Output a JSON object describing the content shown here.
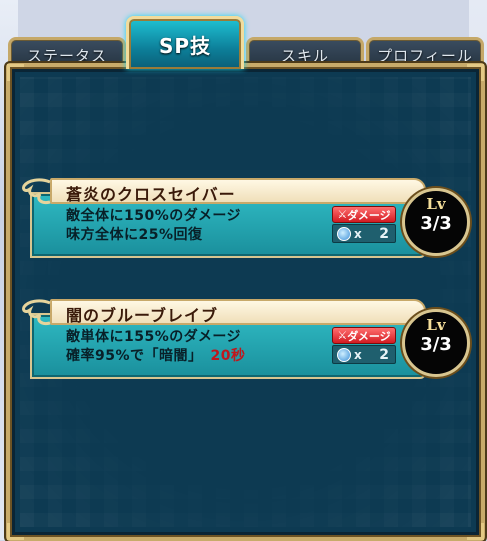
{
  "tabs": [
    {
      "label": "ステータス",
      "active": false
    },
    {
      "label": "SP技",
      "active": true
    },
    {
      "label": "スキル",
      "active": false
    },
    {
      "label": "プロフィール",
      "active": false
    }
  ],
  "skills": [
    {
      "name": "蒼炎のクロスセイバー",
      "line1": "敵全体に150%のダメージ",
      "line2": "味方全体に25%回復",
      "duration": "",
      "tag": "ダメージ",
      "cost_icon": "blue-orb-icon",
      "cost_x": "x",
      "cost": "2",
      "level_label": "Lv",
      "level": "3/3"
    },
    {
      "name": "闇のブルーブレイブ",
      "line1": "敵単体に155%のダメージ",
      "line2": "確率95%で「暗闇」",
      "duration": "20秒",
      "tag": "ダメージ",
      "cost_icon": "blue-orb-icon",
      "cost_x": "x",
      "cost": "2",
      "level_label": "Lv",
      "level": "3/3"
    }
  ],
  "colors": {
    "panel_bg": "#0d3a52",
    "gold_border": "#c8ab6a",
    "card_teal": "#2fb9c2",
    "active_tab": "#1fc1d3",
    "damage_tag": "#d21b22",
    "duration_text": "#c0161c"
  }
}
